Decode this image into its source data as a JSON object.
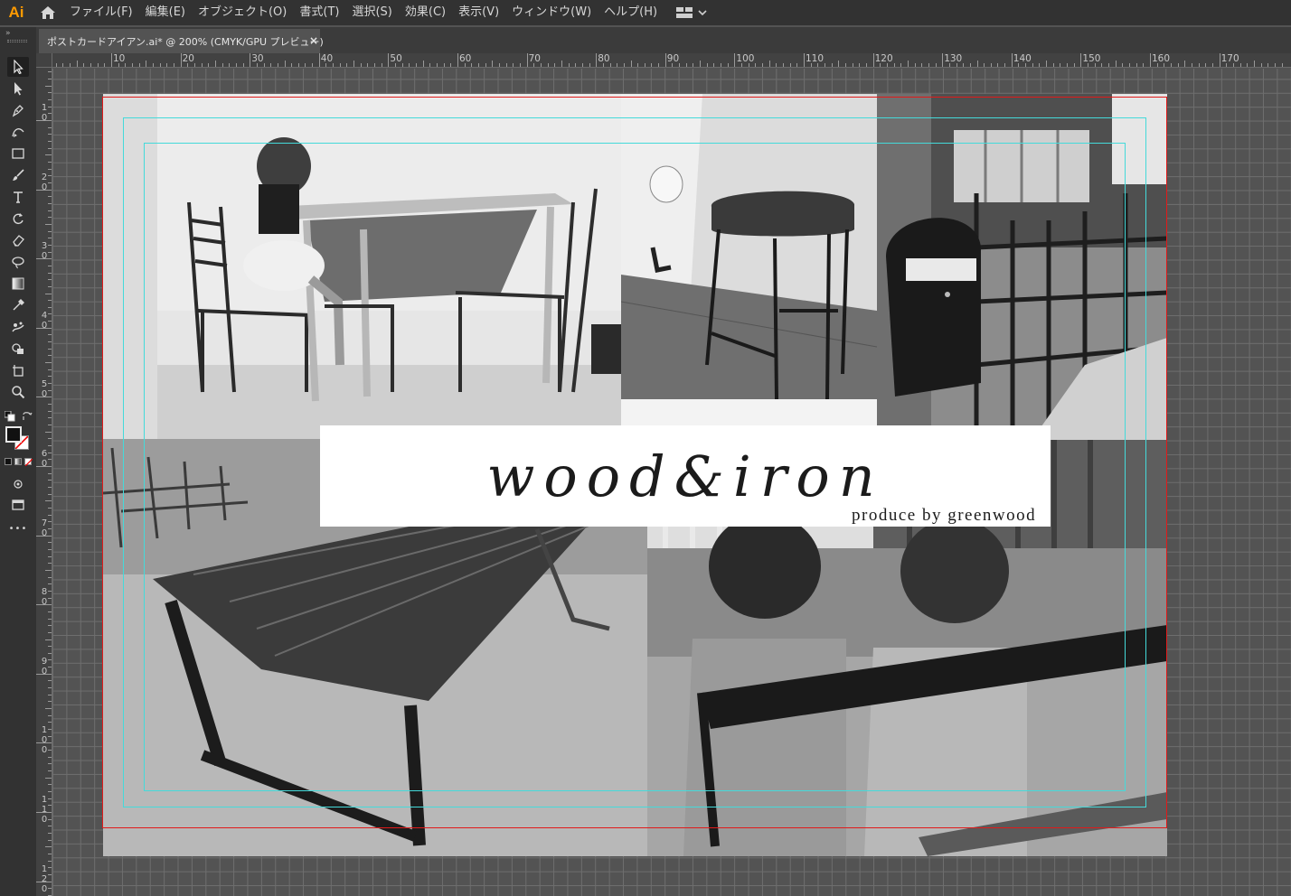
{
  "app": {
    "logo": "Ai"
  },
  "menu": {
    "items": [
      {
        "label": "ファイル(F)"
      },
      {
        "label": "編集(E)"
      },
      {
        "label": "オブジェクト(O)"
      },
      {
        "label": "書式(T)"
      },
      {
        "label": "選択(S)"
      },
      {
        "label": "効果(C)"
      },
      {
        "label": "表示(V)"
      },
      {
        "label": "ウィンドウ(W)"
      },
      {
        "label": "ヘルプ(H)"
      }
    ]
  },
  "tab": {
    "title": "ポストカードアイアン.ai* @ 200% (CMYK/GPU プレビュー)",
    "close": "×"
  },
  "ruler": {
    "h_labels": [
      "10",
      "20",
      "30",
      "40",
      "50",
      "60",
      "70",
      "80",
      "90",
      "100",
      "110",
      "120",
      "130",
      "140",
      "150",
      "160",
      "170"
    ],
    "v_labels": [
      "10",
      "20",
      "30",
      "40",
      "50",
      "60",
      "70",
      "80",
      "90",
      "100",
      "110",
      "120"
    ]
  },
  "toolbar": {
    "tools": [
      "selection",
      "direct-selection",
      "pen",
      "curvature",
      "rectangle",
      "paintbrush",
      "type",
      "rotate",
      "eraser",
      "lasso",
      "gradient",
      "eyedropper",
      "puppet-warp",
      "shape-builder",
      "artboard",
      "zoom"
    ],
    "more": "•••"
  },
  "artwork": {
    "logo_text": "wood&iron",
    "tagline": "produce by greenwood"
  },
  "colors": {
    "app_bg": "#535353",
    "chrome": "#323232",
    "artboard_border": "#e11a1a",
    "guide": "#44dada",
    "logo_accent": "#ff9a00"
  }
}
